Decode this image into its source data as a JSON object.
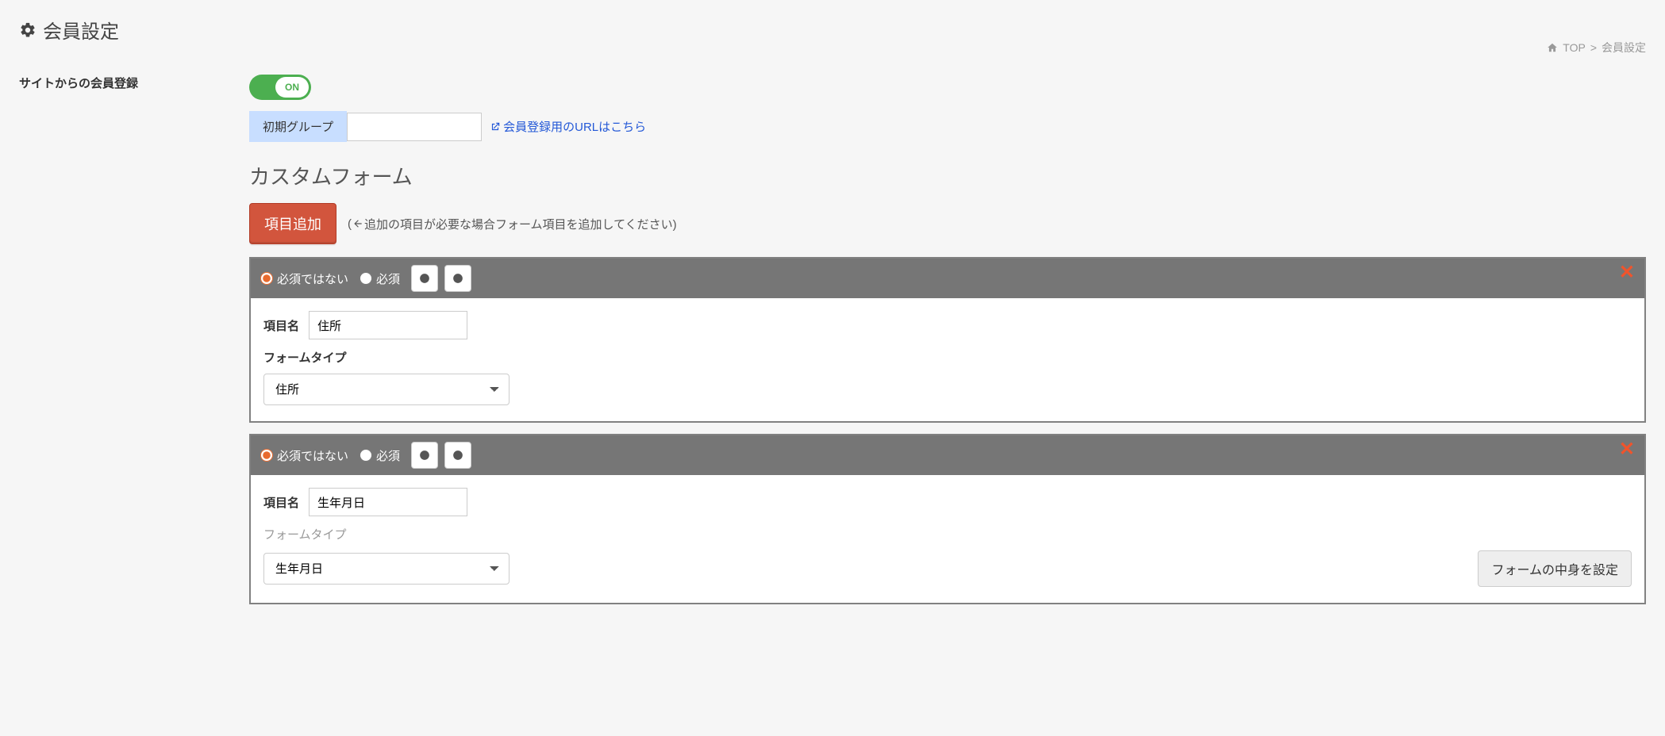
{
  "page": {
    "title": "会員設定"
  },
  "breadcrumb": {
    "top": "TOP",
    "sep": ">",
    "current": "会員設定"
  },
  "leftLabel": "サイトからの会員登録",
  "toggle": {
    "label": "ON"
  },
  "initialGroup": {
    "label": "初期グループ",
    "value": ""
  },
  "registerUrlLink": "会員登録用のURLはこちら",
  "customFormHeading": "カスタムフォーム",
  "addButton": "項目追加",
  "hintPrefix": "(",
  "hintText": "追加の項目が必要な場合フォーム項目を追加してください)",
  "itemNameLabel": "項目名",
  "formTypeLabel": "フォームタイプ",
  "radioNotRequired": "必須ではない",
  "radioRequired": "必須",
  "contentConfigButton": "フォームの中身を設定",
  "items": [
    {
      "nameValue": "住所",
      "typeValue": "住所",
      "subtitleInactive": false,
      "showContentConfig": false
    },
    {
      "nameValue": "生年月日",
      "typeValue": "生年月日",
      "subtitleInactive": true,
      "showContentConfig": true
    }
  ]
}
